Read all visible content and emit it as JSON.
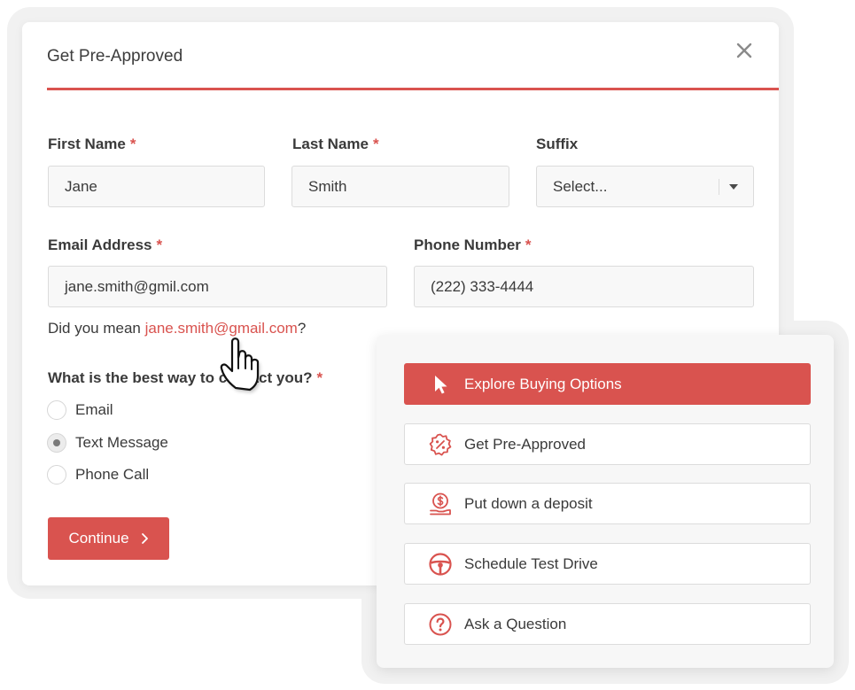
{
  "dialog": {
    "title": "Get Pre-Approved",
    "close_icon": "close-icon"
  },
  "form": {
    "first_name": {
      "label": "First Name",
      "required": "*",
      "value": "Jane"
    },
    "last_name": {
      "label": "Last Name",
      "required": "*",
      "value": "Smith"
    },
    "suffix": {
      "label": "Suffix",
      "placeholder": "Select..."
    },
    "email": {
      "label": "Email Address",
      "required": "*",
      "value": "jane.smith@gmil.com"
    },
    "phone": {
      "label": "Phone Number",
      "required": "*",
      "value": "(222) 333-4444"
    },
    "suggestion": {
      "prefix": "Did you mean ",
      "link": "jane.smith@gmail.com",
      "suffix": "?"
    },
    "contact_question": {
      "label": "What is the best way to contact you?",
      "required": "*",
      "options": [
        {
          "label": "Email",
          "checked": false
        },
        {
          "label": "Text Message",
          "checked": true
        },
        {
          "label": "Phone Call",
          "checked": false
        }
      ]
    },
    "continue_label": "Continue"
  },
  "menu": {
    "items": [
      {
        "label": "Explore Buying Options",
        "icon": "cursor-arrow-icon",
        "active": true
      },
      {
        "label": "Get Pre-Approved",
        "icon": "percent-badge-icon",
        "active": false
      },
      {
        "label": "Put down a deposit",
        "icon": "dollar-hand-icon",
        "active": false
      },
      {
        "label": "Schedule Test Drive",
        "icon": "steering-wheel-icon",
        "active": false
      },
      {
        "label": "Ask a Question",
        "icon": "question-circle-icon",
        "active": false
      }
    ]
  },
  "colors": {
    "accent": "#d9534f",
    "input_bg": "#f8f8f8",
    "text": "#3a3a3a"
  }
}
